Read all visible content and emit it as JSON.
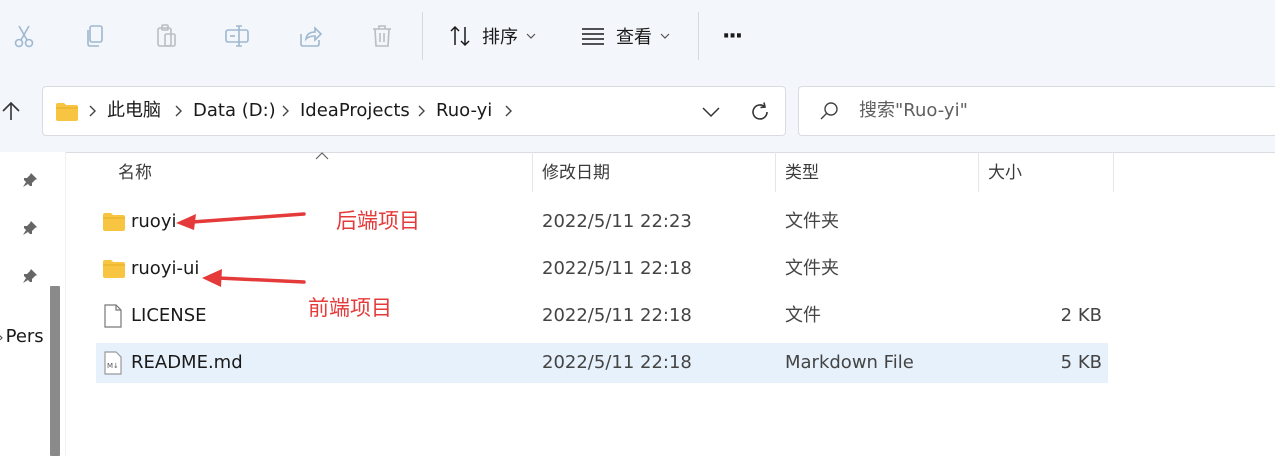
{
  "toolbar": {
    "icons": [
      "cut-icon",
      "copy-icon",
      "paste-icon",
      "rename-icon",
      "share-icon",
      "delete-icon"
    ],
    "sort_label": "排序",
    "view_label": "查看",
    "more_label": "···"
  },
  "address_bar": {
    "crumbs": [
      "此电脑",
      "Data (D:)",
      "IdeaProjects",
      "Ruo-yi"
    ]
  },
  "search": {
    "placeholder": "搜索\"Ruo-yi\""
  },
  "sidebar": {
    "partial_text": "Pers"
  },
  "columns": {
    "name": "名称",
    "modified": "修改日期",
    "type": "类型",
    "size": "大小"
  },
  "files": [
    {
      "name": "ruoyi",
      "modified": "2022/5/11 22:23",
      "type": "文件夹",
      "size": "",
      "icon": "folder-icon"
    },
    {
      "name": "ruoyi-ui",
      "modified": "2022/5/11 22:18",
      "type": "文件夹",
      "size": "",
      "icon": "folder-icon"
    },
    {
      "name": "LICENSE",
      "modified": "2022/5/11 22:18",
      "type": "文件",
      "size": "2 KB",
      "icon": "file-icon"
    },
    {
      "name": "README.md",
      "modified": "2022/5/11 22:18",
      "type": "Markdown File",
      "size": "5 KB",
      "icon": "markdown-file-icon",
      "selected": true
    }
  ],
  "annotations": {
    "backend": "后端项目",
    "frontend": "前端项目",
    "color": "#e53a3a"
  },
  "colors": {
    "folder": "#f8c543",
    "selection": "#e6f1fc",
    "accent": "#2b6cc4"
  }
}
